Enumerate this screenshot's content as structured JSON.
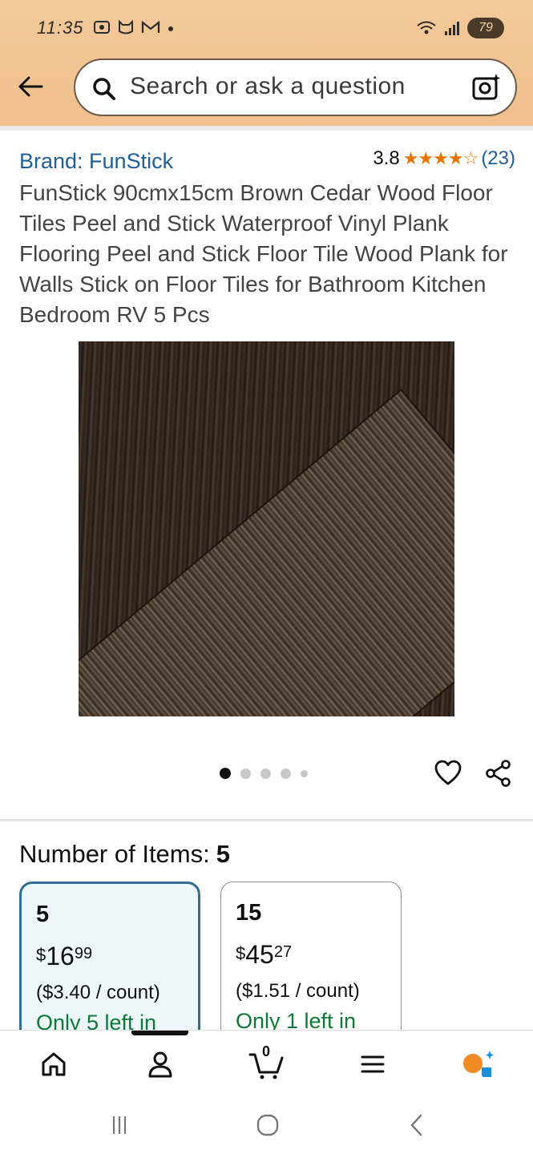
{
  "status": {
    "time": "11:35",
    "battery": "79"
  },
  "search": {
    "placeholder": "Search or ask a question"
  },
  "product": {
    "brand": "Brand: FunStick",
    "rating": "3.8",
    "rating_stars": 3.8,
    "review_count": "(23)",
    "title": "FunStick 90cmx15cm Brown Cedar Wood Floor Tiles Peel and Stick Waterproof Vinyl Plank Flooring Peel and Stick Floor Tile Wood Plank for Walls Stick on Floor Tiles for Bathroom Kitchen Bedroom RV 5 Pcs"
  },
  "carousel": {
    "total": 5,
    "active_index": 0
  },
  "variants": {
    "label": "Number of Items:",
    "selected_value": "5",
    "options": [
      {
        "qty": "5",
        "price_symbol": "$",
        "price_whole": "16",
        "price_cents": "99",
        "unit_price": "($3.40 / count)",
        "stock": "Only 5 left in"
      },
      {
        "qty": "15",
        "price_symbol": "$",
        "price_whole": "45",
        "price_cents": "27",
        "unit_price": "($1.51 / count)",
        "stock": "Only 1 left in"
      }
    ]
  },
  "bottom_nav": {
    "cart_count": "0"
  },
  "colors": {
    "header_bg": "#f2c99a",
    "link_blue": "#1f5f99",
    "star_orange": "#e77600",
    "stock_green": "#0b7a34",
    "selected_border": "#2f6e98"
  }
}
